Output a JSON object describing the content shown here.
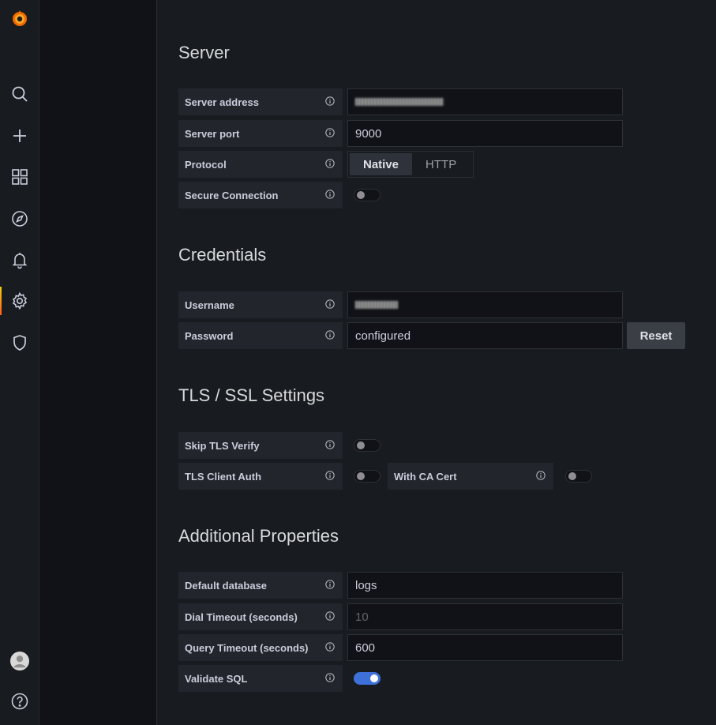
{
  "sidebar": {
    "items": [
      {
        "icon": "grafana-logo-icon"
      },
      {
        "icon": "search-icon"
      },
      {
        "icon": "plus-icon"
      },
      {
        "icon": "dashboards-icon"
      },
      {
        "icon": "explore-compass-icon"
      },
      {
        "icon": "alerting-bell-icon"
      },
      {
        "icon": "configuration-gear-icon"
      },
      {
        "icon": "server-admin-shield-icon"
      },
      {
        "icon": "user-avatar-icon"
      },
      {
        "icon": "help-icon"
      }
    ],
    "active": "configuration-gear-icon",
    "accent": "#ff5f1f"
  },
  "sections": {
    "server": {
      "title": "Server",
      "address_label": "Server address",
      "port_label": "Server port",
      "port_value": "9000",
      "protocol_label": "Protocol",
      "protocol_options": [
        "Native",
        "HTTP"
      ],
      "protocol_selected": "Native",
      "secure_label": "Secure Connection",
      "secure_on": false
    },
    "credentials": {
      "title": "Credentials",
      "username_label": "Username",
      "password_label": "Password",
      "password_value": "configured",
      "reset_label": "Reset"
    },
    "tls": {
      "title": "TLS / SSL Settings",
      "skip_verify_label": "Skip TLS Verify",
      "skip_verify_on": false,
      "client_auth_label": "TLS Client Auth",
      "client_auth_on": false,
      "ca_cert_label": "With CA Cert",
      "ca_cert_on": false
    },
    "additional": {
      "title": "Additional Properties",
      "default_db_label": "Default database",
      "default_db_value": "logs",
      "dial_timeout_label": "Dial Timeout (seconds)",
      "dial_timeout_placeholder": "10",
      "query_timeout_label": "Query Timeout (seconds)",
      "query_timeout_value": "600",
      "validate_sql_label": "Validate SQL",
      "validate_sql_on": true
    }
  },
  "colors": {
    "toggle_on": "#3d71d9",
    "background": "#181b1f"
  }
}
